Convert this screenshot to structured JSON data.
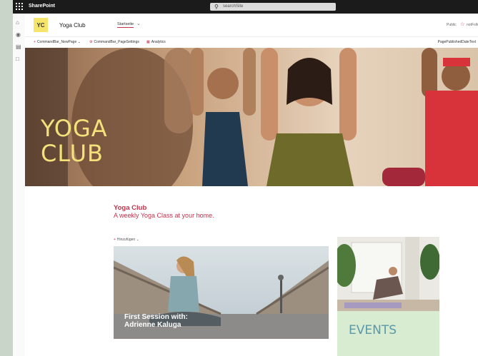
{
  "suite_bar": {
    "app_name": "SharePoint",
    "search_placeholder": "searchSite",
    "icons": [
      "waffle-icon",
      "search-icon"
    ]
  },
  "left_rail": {
    "icons": [
      "home-icon",
      "globe-icon",
      "news-icon",
      "document-icon"
    ]
  },
  "site_header": {
    "logo_initials": "YC",
    "site_title": "Yoga Club",
    "nav_link": "Startseite",
    "visibility": "Public",
    "follow_label": "notFollowing"
  },
  "command_bar": {
    "new_page": "CommandBar_NewPage",
    "page_settings": "CommandBar_PageSettings",
    "analytics": "Analytics",
    "status": "PagePublishedDateText"
  },
  "hero": {
    "title_line1": "YOGA",
    "title_line2": "CLUB"
  },
  "news": {
    "title": "Yoga Club",
    "subtitle": "A weekly Yoga Class at your home.",
    "add_label": "Hinzufügen",
    "card_caption_line1": "First Session with:",
    "card_caption_line2": "Adrienne Kaluga"
  },
  "events": {
    "title": "EVENTS"
  },
  "colors": {
    "suite_bar": "#1b1b1b",
    "accent": "#c4314b",
    "hero_title": "#f3e27a",
    "logo_bg": "#f5e56b",
    "events_bg": "#d8ecd2",
    "events_text": "#5a98a8"
  }
}
